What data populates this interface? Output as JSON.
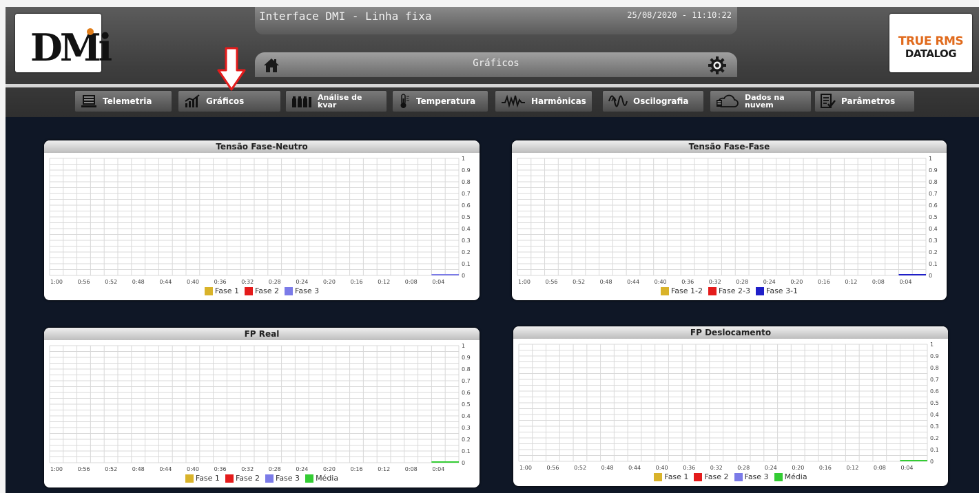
{
  "header": {
    "logo_text": "DMi",
    "title": "Interface DMI - Linha fixa",
    "datetime": "25/08/2020 - 11:10:22",
    "page_title": "Gráficos",
    "badge_line1": "TRUE RMS",
    "badge_line2": "DATALOG"
  },
  "nav": {
    "items": [
      {
        "label": "Telemetria",
        "icon": "server-rack-icon"
      },
      {
        "label": "Gráficos",
        "icon": "bar-chart-icon"
      },
      {
        "label": "Análise de kvar",
        "icon": "capacitor-bank-icon"
      },
      {
        "label": "Temperatura",
        "icon": "thermometer-icon"
      },
      {
        "label": "Harmônicas",
        "icon": "harmonic-wave-icon"
      },
      {
        "label": "Oscilografia",
        "icon": "oscillography-wave-icon"
      },
      {
        "label": "Dados na nuvem",
        "icon": "cloud-data-icon"
      },
      {
        "label": "Parâmetros",
        "icon": "checklist-icon"
      }
    ]
  },
  "colors": {
    "fase1": "#d9b32a",
    "fase2": "#e41b1b",
    "fase3": "#7b7be8",
    "fase3_dark": "#1f1fc9",
    "media": "#33cc33",
    "brand_orange": "#e06a1c",
    "arrow_red": "#e41b1b"
  },
  "chart_data": [
    {
      "type": "line",
      "title": "Tensão Fase-Neutro",
      "x": [
        "1:00",
        "0:56",
        "0:52",
        "0:48",
        "0:44",
        "0:40",
        "0:36",
        "0:32",
        "0:28",
        "0:24",
        "0:20",
        "0:16",
        "0:12",
        "0:08",
        "0:04"
      ],
      "y_ticks": [
        "1",
        "0.9",
        "0.8",
        "0.7",
        "0.6",
        "0.5",
        "0.4",
        "0.3",
        "0.2",
        "0.1",
        "0"
      ],
      "ylim": [
        0,
        1
      ],
      "grid": true,
      "legend_position": "bottom",
      "series": [
        {
          "name": "Fase 1",
          "color": "#d9b32a",
          "values": []
        },
        {
          "name": "Fase 2",
          "color": "#e41b1b",
          "values": []
        },
        {
          "name": "Fase 3",
          "color": "#7b7be8",
          "values": [
            0,
            0
          ]
        }
      ]
    },
    {
      "type": "line",
      "title": "Tensão Fase-Fase",
      "x": [
        "1:00",
        "0:56",
        "0:52",
        "0:48",
        "0:44",
        "0:40",
        "0:36",
        "0:32",
        "0:28",
        "0:24",
        "0:20",
        "0:16",
        "0:12",
        "0:08",
        "0:04"
      ],
      "y_ticks": [
        "1",
        "0.9",
        "0.8",
        "0.7",
        "0.6",
        "0.5",
        "0.4",
        "0.3",
        "0.2",
        "0.1",
        "0"
      ],
      "ylim": [
        0,
        1
      ],
      "grid": true,
      "legend_position": "bottom",
      "series": [
        {
          "name": "Fase 1-2",
          "color": "#d9b32a",
          "values": []
        },
        {
          "name": "Fase 2-3",
          "color": "#e41b1b",
          "values": []
        },
        {
          "name": "Fase 3-1",
          "color": "#1f1fc9",
          "values": [
            0,
            0
          ]
        }
      ]
    },
    {
      "type": "line",
      "title": "FP Real",
      "x": [
        "1:00",
        "0:56",
        "0:52",
        "0:48",
        "0:44",
        "0:40",
        "0:36",
        "0:32",
        "0:28",
        "0:24",
        "0:20",
        "0:16",
        "0:12",
        "0:08",
        "0:04"
      ],
      "y_ticks": [
        "1",
        "0.9",
        "0.8",
        "0.7",
        "0.6",
        "0.5",
        "0.4",
        "0.3",
        "0.2",
        "0.1",
        "0"
      ],
      "ylim": [
        0,
        1
      ],
      "grid": true,
      "legend_position": "bottom",
      "series": [
        {
          "name": "Fase 1",
          "color": "#d9b32a",
          "values": []
        },
        {
          "name": "Fase 2",
          "color": "#e41b1b",
          "values": []
        },
        {
          "name": "Fase 3",
          "color": "#7b7be8",
          "values": []
        },
        {
          "name": "Média",
          "color": "#33cc33",
          "values": [
            0,
            0
          ]
        }
      ]
    },
    {
      "type": "line",
      "title": "FP Deslocamento",
      "x": [
        "1:00",
        "0:56",
        "0:52",
        "0:48",
        "0:44",
        "0:40",
        "0:36",
        "0:32",
        "0:28",
        "0:24",
        "0:20",
        "0:16",
        "0:12",
        "0:08",
        "0:04"
      ],
      "y_ticks": [
        "1",
        "0.9",
        "0.8",
        "0.7",
        "0.6",
        "0.5",
        "0.4",
        "0.3",
        "0.2",
        "0.1",
        "0"
      ],
      "ylim": [
        0,
        1
      ],
      "grid": true,
      "legend_position": "bottom",
      "series": [
        {
          "name": "Fase 1",
          "color": "#d9b32a",
          "values": []
        },
        {
          "name": "Fase 2",
          "color": "#e41b1b",
          "values": []
        },
        {
          "name": "Fase 3",
          "color": "#7b7be8",
          "values": []
        },
        {
          "name": "Média",
          "color": "#33cc33",
          "values": [
            0,
            0
          ]
        }
      ]
    }
  ]
}
